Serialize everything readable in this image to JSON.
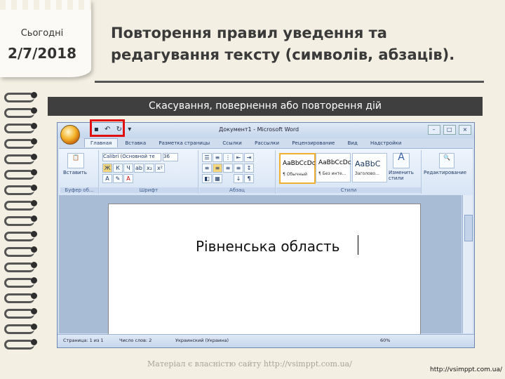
{
  "slide": {
    "date_label": "Сьогодні",
    "date_value": "2/7/2018",
    "title_line1": "Повторення правил уведення та",
    "title_line2": "редагування тексту (символів, абзаців).",
    "caption": "Скасування, повернення або повторення дій",
    "watermark": "Матеріал є власністю сайту http://vsimppt.com.ua/",
    "url": "http://vsimppt.com.ua/"
  },
  "word": {
    "window_title": "Документ1 - Microsoft Word",
    "qat": {
      "undo_icon": "undo-icon",
      "redo_icon": "redo-icon",
      "customize_icon": "dropdown-icon"
    },
    "tabs": [
      "Главная",
      "Вставка",
      "Разметка страницы",
      "Ссылки",
      "Рассылки",
      "Рецензирование",
      "Вид",
      "Надстройки"
    ],
    "groups": {
      "clipboard": {
        "label": "Буфер об...",
        "paste": "Вставить"
      },
      "font": {
        "label": "Шрифт",
        "font_name": "Calibri (Основной те",
        "font_size": "36"
      },
      "paragraph": {
        "label": "Абзац"
      },
      "styles": {
        "label": "Стили",
        "items": [
          {
            "sample": "AaBbCcDc",
            "name": "¶ Обычный"
          },
          {
            "sample": "AaBbCcDc",
            "name": "¶ Без инте..."
          },
          {
            "sample": "AaBbC",
            "name": "Заголово..."
          }
        ],
        "change_styles": "Изменить стили"
      },
      "editing": {
        "label": "Редактирование"
      }
    },
    "document_text": "Рівненська область",
    "status": {
      "page": "Страница: 1 из 1",
      "words": "Число слов: 2",
      "language": "Украинский (Украина)",
      "zoom": "60%"
    }
  }
}
